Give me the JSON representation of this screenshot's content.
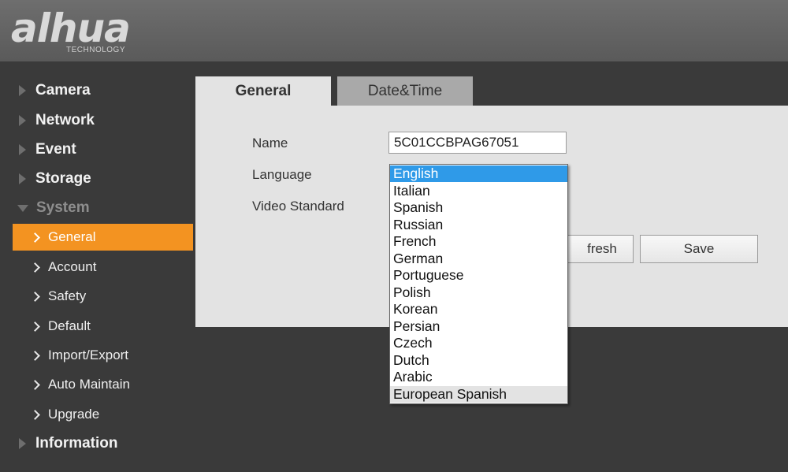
{
  "header": {
    "logo_main": "alhua",
    "logo_sub": "TECHNOLOGY"
  },
  "sidebar": {
    "items": [
      {
        "label": "Camera"
      },
      {
        "label": "Network"
      },
      {
        "label": "Event"
      },
      {
        "label": "Storage"
      },
      {
        "label": "System",
        "expanded": true
      }
    ],
    "system_subitems": [
      {
        "label": "General",
        "active": true
      },
      {
        "label": "Account"
      },
      {
        "label": "Safety"
      },
      {
        "label": "Default"
      },
      {
        "label": "Import/Export"
      },
      {
        "label": "Auto Maintain"
      },
      {
        "label": "Upgrade"
      }
    ],
    "bottom_item": {
      "label": "Information"
    }
  },
  "tabs": [
    {
      "label": "General",
      "active": true
    },
    {
      "label": "Date&Time"
    }
  ],
  "form": {
    "name_label": "Name",
    "name_value": "5C01CCBPAG67051",
    "language_label": "Language",
    "video_standard_label": "Video Standard"
  },
  "buttons": {
    "refresh_label": "Refresh",
    "refresh_visible_text": "fresh",
    "save_label": "Save"
  },
  "language_dropdown": {
    "selected": "English",
    "hovered": "European Spanish",
    "options": [
      "English",
      "Italian",
      "Spanish",
      "Russian",
      "French",
      "German",
      "Portuguese",
      "Polish",
      "Korean",
      "Persian",
      "Czech",
      "Dutch",
      "Arabic",
      "European Spanish"
    ]
  },
  "colors": {
    "accent": "#f39321",
    "selection": "#2f9ae8",
    "background": "#3a3a3a"
  }
}
